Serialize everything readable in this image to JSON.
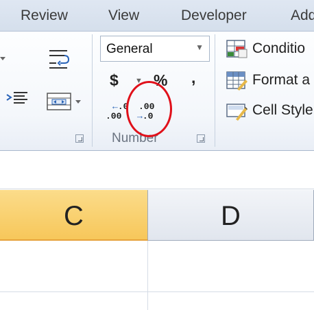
{
  "tabs": [
    "Review",
    "View",
    "Developer",
    "Add"
  ],
  "number_group": {
    "format_value": "General",
    "currency_symbol": "$",
    "percent_symbol": "%",
    "comma_symbol": ",",
    "increase_decimal": {
      "row1": ".0",
      "row2": ".00"
    },
    "decrease_decimal": {
      "row1": ".00",
      "row2": ".0"
    },
    "label": "Number"
  },
  "styles_group": {
    "items": [
      "Conditio",
      "Format a",
      "Cell Style"
    ]
  },
  "columns": [
    "C",
    "D"
  ],
  "icons": [
    "wrap-text-icon",
    "align-indent-icon",
    "merge-center-icon",
    "dialog-launcher-icon",
    "conditional-formatting-icon",
    "format-as-table-icon",
    "cell-styles-icon"
  ],
  "colors": {
    "selected_column": "#f7c75a",
    "highlight_ring": "#e0101a",
    "ribbon_border": "#a9b8cc"
  }
}
